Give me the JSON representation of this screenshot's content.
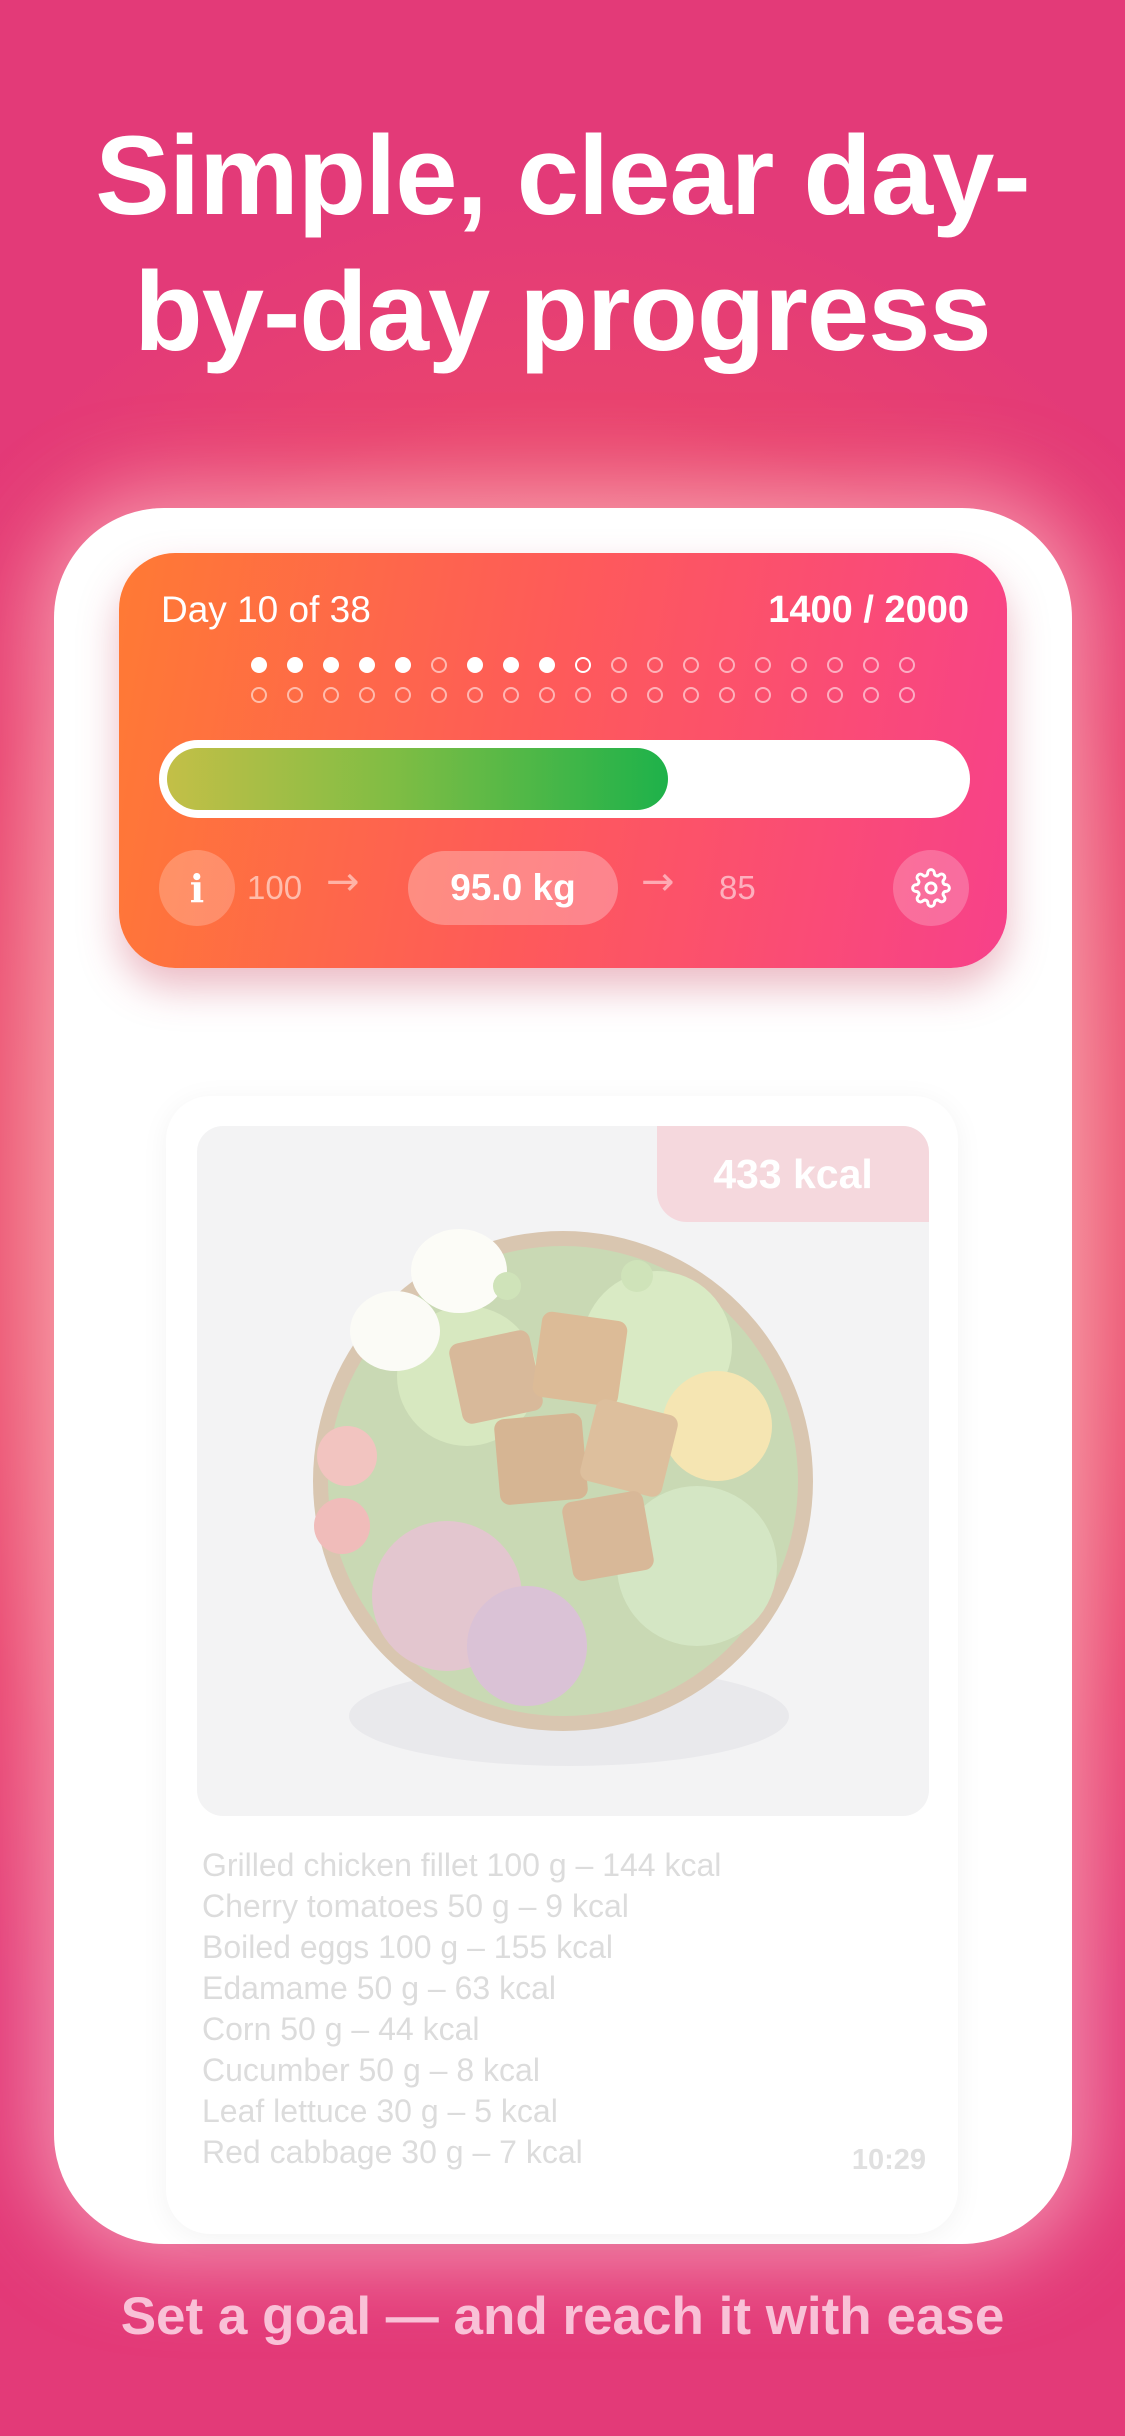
{
  "headline": {
    "line1": "Simple, clear day-",
    "line2": "by-day progress"
  },
  "progress": {
    "day_label": "Day 10 of 38",
    "calories": "1400 / 2000",
    "days_done": 9,
    "current_day": 10,
    "total_days": 38,
    "calorie_fraction": 0.63,
    "start_weight": "100",
    "current_weight": "95.0 kg",
    "goal_weight": "85",
    "arrow_glyph": "→",
    "info_icon": "info-icon",
    "settings_icon": "gear-icon",
    "colors": {
      "gradient_start": "#ff7a34",
      "gradient_end": "#f7418a",
      "bar_start": "#c3bf47",
      "bar_end": "#1eb24a"
    }
  },
  "meal": {
    "kcal_badge": "433 kcal",
    "ingredients": [
      "Grilled chicken fillet 100 g – 144 kcal",
      "Cherry tomatoes 50 g – 9 kcal",
      "Boiled eggs 100 g – 155 kcal",
      "Edamame 50 g – 63 kcal",
      "Corn 50 g – 44 kcal",
      "Cucumber 50 g – 8 kcal",
      "Leaf lettuce 30 g – 5 kcal",
      "Red cabbage 30 g – 7 kcal"
    ],
    "time": "10:29"
  },
  "footer": "Set a goal — and reach it with ease"
}
